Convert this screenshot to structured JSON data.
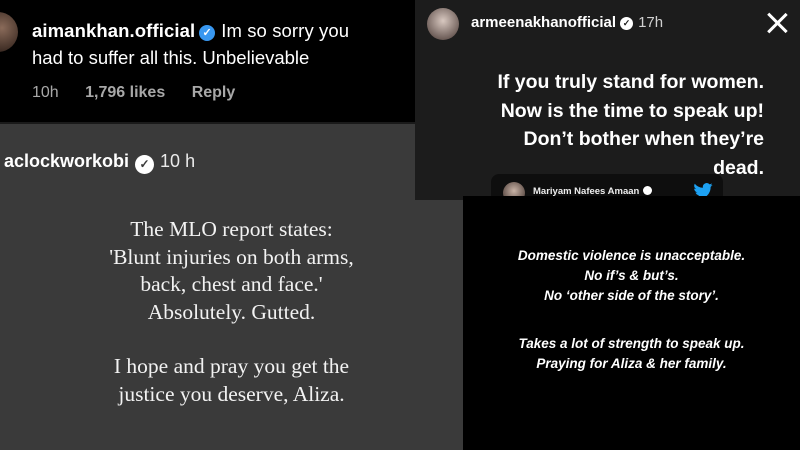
{
  "comment": {
    "username": "aimankhan.official",
    "text_line1": "Im so sorry you",
    "text_line2": "had to suffer all this. Unbelievable",
    "time": "10h",
    "likes": "1,796 likes",
    "reply": "Reply",
    "verified_color": "#3897f0"
  },
  "post": {
    "username": "aclockworkobi",
    "time": "10 h",
    "lines": [
      "The MLO report states:",
      "'Blunt injuries on both arms,",
      "back, chest and face.'",
      "Absolutely. Gutted.",
      "I hope and pray you get the",
      "justice you deserve, Aliza."
    ],
    "background": "#3a3a3a"
  },
  "story": {
    "username": "armeenakhanofficial",
    "time": "17h",
    "lines": [
      "If you truly stand for women.",
      "Now is the time to speak up!",
      "Don’t bother when they’re",
      "dead."
    ],
    "tweet_author": "Mariyam Nafees Amaan",
    "close_icon": "close-icon",
    "twitter_color": "#1da1f2"
  },
  "statement": {
    "lines": [
      "Domestic violence is unacceptable.",
      "No if’s & but’s.",
      "No ‘other side of the story’.",
      "Takes a lot of strength to speak up.",
      "Praying for Aliza & her family."
    ]
  }
}
